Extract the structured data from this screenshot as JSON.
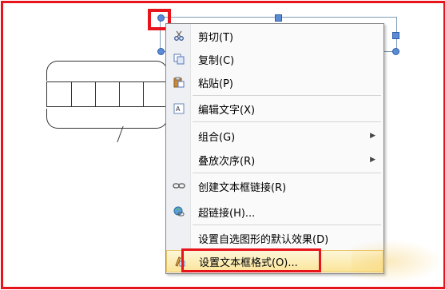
{
  "menu": {
    "items": [
      {
        "label": "剪切(T)",
        "icon": "scissors-icon"
      },
      {
        "label": "复制(C)",
        "icon": "copy-icon"
      },
      {
        "label": "粘贴(P)",
        "icon": "paste-icon"
      },
      {
        "label": "编辑文字(X)",
        "icon": "edit-text-icon"
      },
      {
        "label": "组合(G)",
        "icon": "",
        "submenu": true
      },
      {
        "label": "叠放次序(R)",
        "icon": "",
        "submenu": true
      },
      {
        "label": "创建文本框链接(R)",
        "icon": "link-icon"
      },
      {
        "label": "超链接(H)...",
        "icon": "hyperlink-globe-icon"
      },
      {
        "label": "设置自选图形的默认效果(D)",
        "icon": ""
      },
      {
        "label": "设置文本框格式(O)...",
        "icon": "format-textbox-icon",
        "highlighted": true
      }
    ]
  },
  "colors": {
    "annotation_red": "#e8141c",
    "menu_hover": "#fbe59a"
  }
}
